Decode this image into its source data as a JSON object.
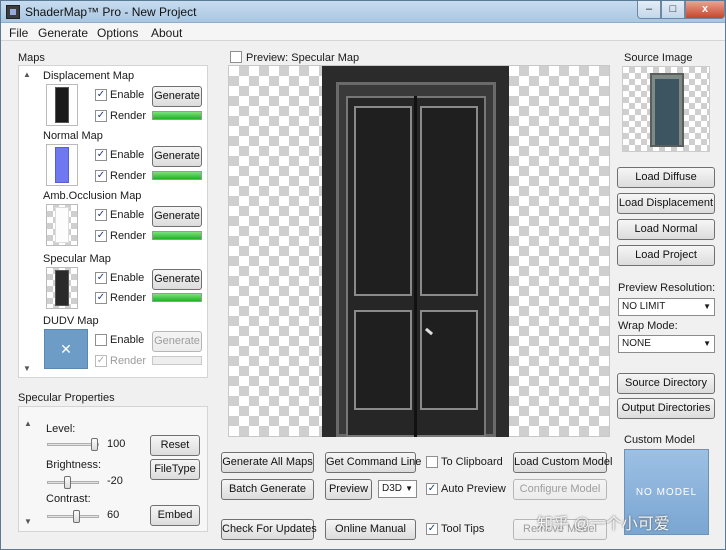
{
  "window": {
    "title": "ShaderMap™ Pro - New Project",
    "min_glyph": "–",
    "max_glyph": "□",
    "close_glyph": "x"
  },
  "menu": [
    "File",
    "Generate",
    "Options",
    "About"
  ],
  "maps_group": {
    "label": "Maps",
    "items": [
      {
        "name": "Displacement Map",
        "enable_label": "Enable",
        "render_label": "Render",
        "enabled": true,
        "render": true,
        "button": "Generate",
        "progress": 1.0,
        "disabled": false
      },
      {
        "name": "Normal Map",
        "enable_label": "Enable",
        "render_label": "Render",
        "enabled": true,
        "render": true,
        "button": "Generate",
        "progress": 1.0,
        "disabled": false
      },
      {
        "name": "Amb.Occlusion Map",
        "enable_label": "Enable",
        "render_label": "Render",
        "enabled": true,
        "render": true,
        "button": "Generate",
        "progress": 1.0,
        "disabled": false
      },
      {
        "name": "Specular Map",
        "enable_label": "Enable",
        "render_label": "Render",
        "enabled": true,
        "render": true,
        "button": "Generate",
        "progress": 1.0,
        "disabled": false
      },
      {
        "name": "DUDV Map",
        "enable_label": "Enable",
        "render_label": "Render",
        "enabled": false,
        "render": true,
        "button": "Generate",
        "progress": 0.0,
        "disabled": true
      }
    ],
    "dudv_glyph": "✕"
  },
  "specular_props": {
    "label": "Specular Properties",
    "level": {
      "label": "Level:",
      "value": "100",
      "fraction": 1.0
    },
    "brightness": {
      "label": "Brightness:",
      "value": "-20",
      "fraction": 0.4
    },
    "contrast": {
      "label": "Contrast:",
      "value": "60",
      "fraction": 0.6
    },
    "reset_button": "Reset",
    "filetype_button": "FileType",
    "embed_button": "Embed"
  },
  "preview": {
    "label": "Preview: Specular Map",
    "checked": false
  },
  "bottom_buttons": {
    "generate_all": "Generate All Maps",
    "get_command_line": "Get Command Line",
    "to_clipboard": "To Clipboard",
    "load_custom_model": "Load Custom Model",
    "batch_generate": "Batch Generate",
    "preview": "Preview",
    "renderer": "D3D",
    "auto_preview": "Auto Preview",
    "configure_model": "Configure Model",
    "check_updates": "Check For Updates",
    "online_manual": "Online Manual",
    "tool_tips": "Tool Tips",
    "remove_model": "Remove Model"
  },
  "checks": {
    "to_clipboard": false,
    "auto_preview": true,
    "tool_tips": true
  },
  "right_panel": {
    "source_image_label": "Source Image",
    "load_diffuse": "Load Diffuse",
    "load_displacement": "Load Displacement",
    "load_normal": "Load Normal",
    "load_project": "Load Project",
    "preview_resolution_label": "Preview Resolution:",
    "preview_resolution_value": "NO LIMIT",
    "wrap_mode_label": "Wrap Mode:",
    "wrap_mode_value": "NONE",
    "source_directory": "Source Directory",
    "output_directories": "Output Directories",
    "custom_model_label": "Custom Model",
    "no_model_text": "NO MODEL"
  },
  "watermark": "知乎 @一个小可爱",
  "colors": {
    "progress_green": "#22b222",
    "normal_map_blue": "#6f78f0",
    "dudv_blue": "#6d9cc6",
    "custom_model_blue": "#8fb6de"
  }
}
